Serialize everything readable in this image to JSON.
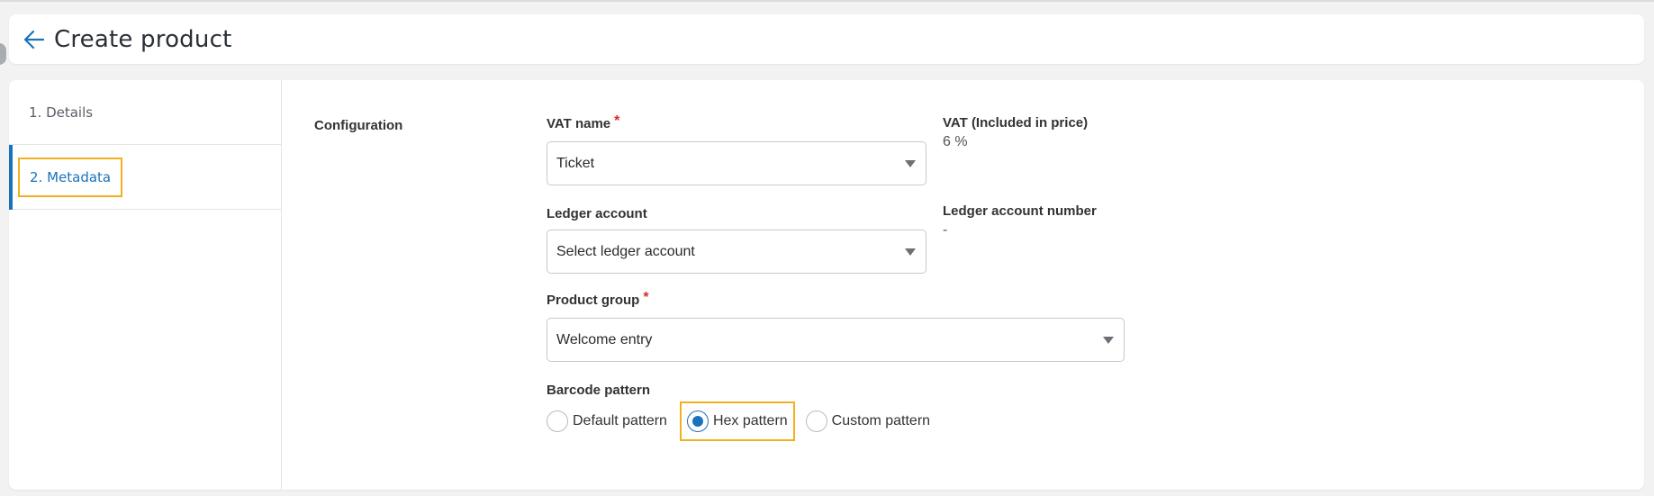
{
  "header": {
    "title": "Create product",
    "back_icon": "arrow-left-icon"
  },
  "sidebar": {
    "steps": [
      {
        "label": "1. Details",
        "active": false
      },
      {
        "label": "2. Metadata",
        "active": true
      }
    ]
  },
  "configuration": {
    "section_title": "Configuration",
    "vat_name": {
      "label": "VAT name",
      "required_mark": "*",
      "value": "Ticket"
    },
    "vat_info": {
      "label": "VAT (Included in price)",
      "value": "6 %"
    },
    "ledger_account": {
      "label": "Ledger account",
      "value": "Select ledger account"
    },
    "ledger_info": {
      "label": "Ledger account number",
      "value": "-"
    },
    "product_group": {
      "label": "Product group",
      "required_mark": "*",
      "value": "Welcome entry"
    },
    "barcode_pattern": {
      "label": "Barcode pattern",
      "options": [
        {
          "label": "Default pattern",
          "selected": false
        },
        {
          "label": "Hex pattern",
          "selected": true
        },
        {
          "label": "Custom pattern",
          "selected": false
        }
      ]
    }
  },
  "colors": {
    "accent": "#1a73ba",
    "highlight": "#f2b01e",
    "required": "#d92b2b"
  }
}
